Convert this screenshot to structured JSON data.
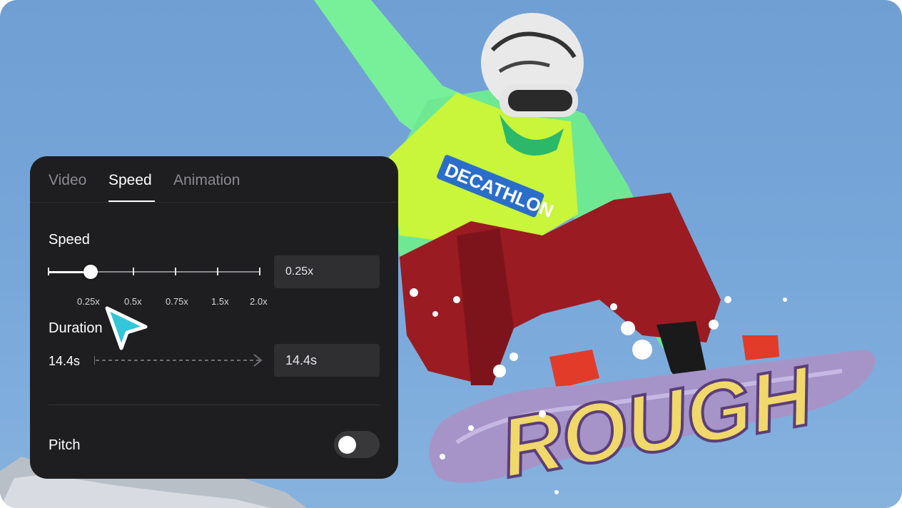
{
  "tabs": [
    {
      "label": "Video",
      "active": false
    },
    {
      "label": "Speed",
      "active": true
    },
    {
      "label": "Animation",
      "active": false
    }
  ],
  "speed": {
    "label": "Speed",
    "value": "0.25x",
    "tick_labels": [
      "0.25x",
      "0.5x",
      "0.75x",
      "1.5x",
      "2.0x"
    ],
    "selected_index": 1
  },
  "duration": {
    "label": "Duration",
    "from": "14.4s",
    "to": "14.4s"
  },
  "pitch": {
    "label": "Pitch",
    "enabled": false
  },
  "photo": {
    "bib_text": "DECATHLON",
    "board_text": "ROUGH"
  },
  "colors": {
    "panel": "#1e1e20",
    "sky": "#78a8da",
    "cursor": "#33c6d8",
    "jacket": "#7cf29c",
    "pants": "#9b1b22"
  }
}
